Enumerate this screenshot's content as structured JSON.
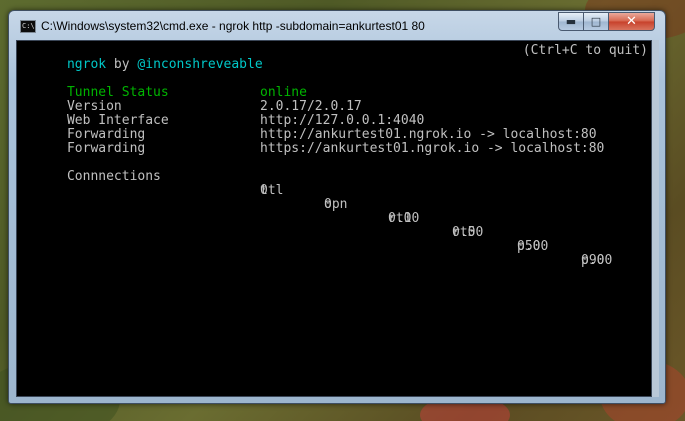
{
  "window": {
    "title": "C:\\Windows\\system32\\cmd.exe - ngrok  http -subdomain=ankurtest01 80",
    "icon": "cmd-icon",
    "controls": {
      "minimize": "minimize-icon",
      "maximize": "maximize-icon",
      "close": "close-icon"
    }
  },
  "console": {
    "header": {
      "app": "ngrok",
      "by": " by ",
      "author": "@inconshreveable",
      "quit_hint": "(Ctrl+C to quit)"
    },
    "status": {
      "label": "Tunnel Status",
      "value": "online"
    },
    "rows": [
      {
        "label": "Version",
        "value": "2.0.17/2.0.17"
      },
      {
        "label": "Web Interface",
        "value": "http://127.0.0.1:4040"
      },
      {
        "label": "Forwarding",
        "value": "http://ankurtest01.ngrok.io -> localhost:80"
      },
      {
        "label": "Forwarding",
        "value": "https://ankurtest01.ngrok.io -> localhost:80"
      }
    ],
    "connections": {
      "label": "Connnections",
      "headers": [
        "ttl",
        "opn",
        "rt1",
        "rt5",
        "p50",
        "p90"
      ],
      "values": [
        "0",
        "0",
        "0.00",
        "0.00",
        "0.00",
        "0.00"
      ]
    }
  },
  "colors": {
    "console_bg": "#000000",
    "text_gray": "#c0c0c0",
    "text_cyan": "#00c8c8",
    "text_green": "#00b400"
  }
}
